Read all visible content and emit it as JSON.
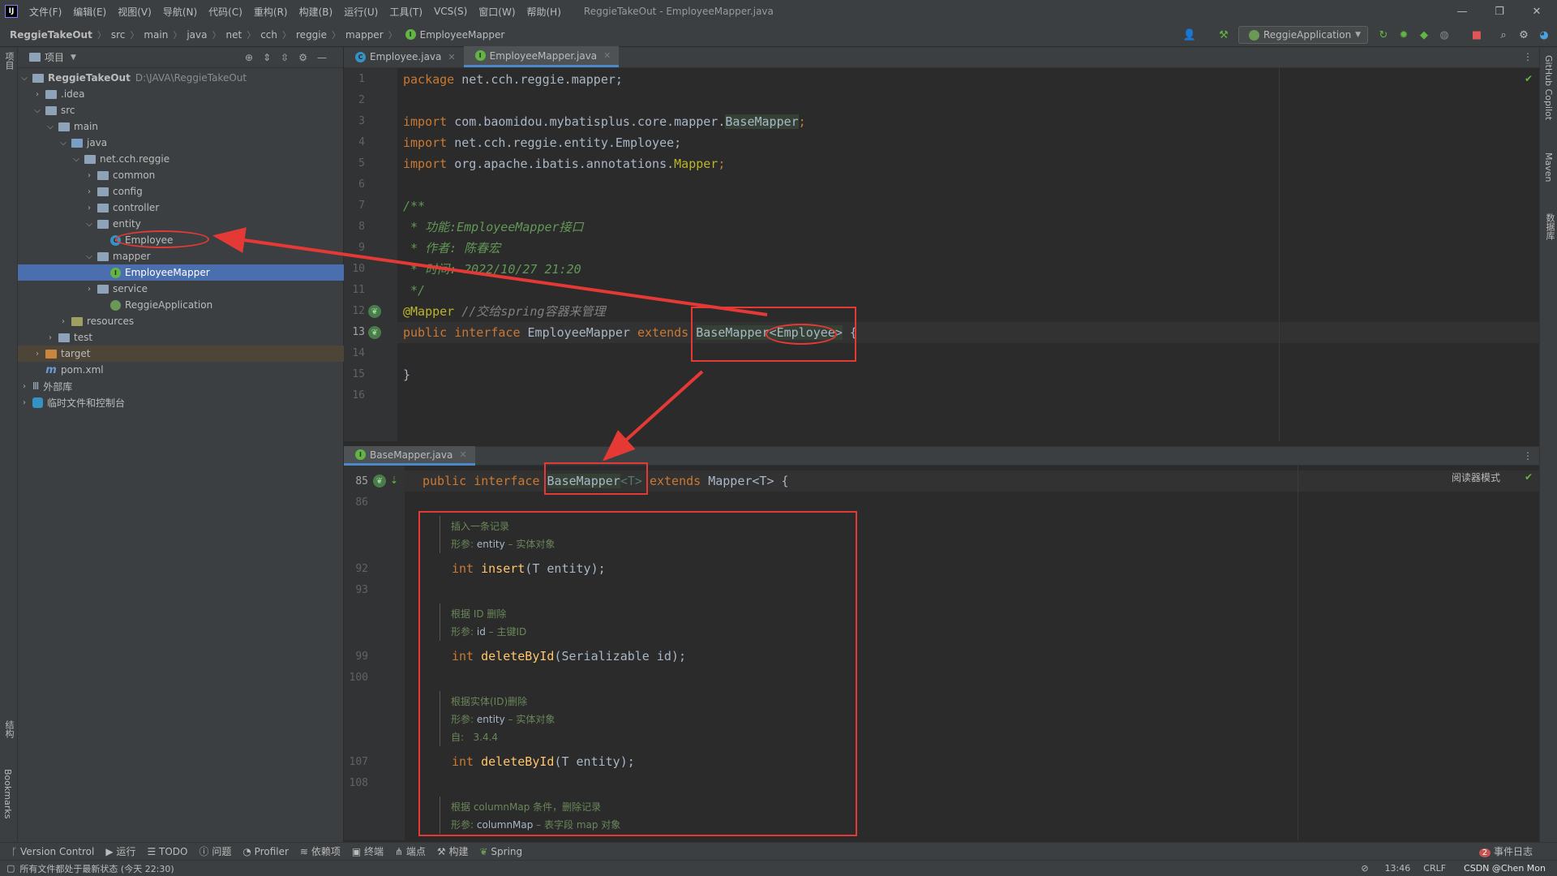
{
  "titlebar": {
    "logo": "IJ",
    "menus": [
      "文件(F)",
      "编辑(E)",
      "视图(V)",
      "导航(N)",
      "代码(C)",
      "重构(R)",
      "构建(B)",
      "运行(U)",
      "工具(T)",
      "VCS(S)",
      "窗口(W)",
      "帮助(H)"
    ],
    "title": "ReggieTakeOut - EmployeeMapper.java",
    "min": "—",
    "restore": "❐",
    "close": "✕"
  },
  "navbar": {
    "crumbs": [
      "ReggieTakeOut",
      "src",
      "main",
      "java",
      "net",
      "cch",
      "reggie",
      "mapper",
      "EmployeeMapper"
    ],
    "run_config": "ReggieApplication"
  },
  "left_stripe": {
    "project": "项目",
    "structure": "结构",
    "bookmarks": "Bookmarks"
  },
  "right_stripe": {
    "copilot": "GitHub Copilot",
    "maven": "Maven",
    "database": "数据库"
  },
  "project_panel": {
    "header": "项目",
    "tree": [
      {
        "label": "ReggieTakeOut",
        "extra": "D:\\JAVA\\ReggieTakeOut"
      },
      {
        "label": ".idea"
      },
      {
        "label": "src"
      },
      {
        "label": "main"
      },
      {
        "label": "java"
      },
      {
        "label": "net.cch.reggie"
      },
      {
        "label": "common"
      },
      {
        "label": "config"
      },
      {
        "label": "controller"
      },
      {
        "label": "entity"
      },
      {
        "label": "Employee"
      },
      {
        "label": "mapper"
      },
      {
        "label": "EmployeeMapper"
      },
      {
        "label": "service"
      },
      {
        "label": "ReggieApplication"
      },
      {
        "label": "resources"
      },
      {
        "label": "test"
      },
      {
        "label": "target"
      },
      {
        "label": "pom.xml"
      },
      {
        "label": "外部库"
      },
      {
        "label": "临时文件和控制台"
      }
    ]
  },
  "editor_tabs": [
    {
      "label": "Employee.java"
    },
    {
      "label": "EmployeeMapper.java"
    }
  ],
  "editor1": {
    "line_numbers": [
      "1",
      "2",
      "3",
      "4",
      "5",
      "6",
      "7",
      "8",
      "9",
      "10",
      "11",
      "12",
      "13",
      "14",
      "15",
      "16"
    ],
    "l1_kw": "package",
    "l1_rest": " net.cch.reggie.mapper;",
    "l3_kw": "import",
    "l3_rest": " com.baomidou.mybatisplus.core.mapper.",
    "l3_type": "BaseMapper",
    "l3_end": ";",
    "l4_kw": "import",
    "l4_rest": " net.cch.reggie.entity.Employee;",
    "l5_kw": "import",
    "l5_rest": " org.apache.ibatis.annotations.",
    "l5_type": "Mapper",
    "l5_end": ";",
    "l7": "/**",
    "l8": " * 功能:EmployeeMapper接口",
    "l9": " * 作者: 陈春宏",
    "l10": " * 时间: 2022/10/27 21:20",
    "l11": " */",
    "l12_ann": "@Mapper",
    "l12_cm": " //交给spring容器来管理",
    "l13_kw": "public interface",
    "l13_name": " EmployeeMapper ",
    "l13_kw2": "extends",
    "l13_sp": " ",
    "l13_type": "BaseMapper",
    "l13_gen": "<Employee>",
    "l13_end": " {",
    "l15": "}"
  },
  "editor2": {
    "tab": "BaseMapper.java",
    "reader_mode": "阅读器模式",
    "ln85": "85",
    "ln86": "86",
    "ln92": "92",
    "ln93": "93",
    "ln99": "99",
    "ln100": "100",
    "ln107": "107",
    "ln108": "108",
    "l85_kw": "public interface",
    "l85_type": "BaseMapper",
    "l85_gen": "<T>",
    "l85_kw2": " extends",
    "l85_rest": " Mapper<T> {",
    "doc1_a": "插入一条记录",
    "doc1_b_lbl": "形参:",
    "doc1_b_p": "entity",
    "doc1_b_d": " – 实体对象",
    "l92_kw": "int",
    "l92_fn": "insert",
    "l92_rest": "(T entity);",
    "doc2_a": "根据 ID 删除",
    "doc2_b_lbl": "形参:",
    "doc2_b_p": "id",
    "doc2_b_d": " – 主键ID",
    "l99_kw": "int",
    "l99_fn": "deleteById",
    "l99_rest": "(Serializable id);",
    "doc3_a": "根据实体(ID)删除",
    "doc3_b_lbl": "形参:",
    "doc3_b_p": "entity",
    "doc3_b_d": " – 实体对象",
    "doc3_c_lbl": "自:",
    "doc3_c_v": "3.4.4",
    "l107_kw": "int",
    "l107_fn": "deleteById",
    "l107_rest": "(T entity);",
    "doc4_a": "根据 columnMap 条件，删除记录",
    "doc4_b_lbl": "形参:",
    "doc4_b_p": "columnMap",
    "doc4_b_d": " – 表字段 map 对象"
  },
  "bottom_tools": [
    "Version Control",
    "运行",
    "TODO",
    "问题",
    "Profiler",
    "依赖项",
    "终端",
    "端点",
    "构建",
    "Spring"
  ],
  "event_log": {
    "count": "2",
    "label": "事件日志"
  },
  "status": {
    "message": "所有文件都处于最新状态 (今天 22:30)",
    "time": "13:46",
    "line_sep": "CRLF",
    "watermark": "CSDN @Chen Mon"
  },
  "colors": {
    "accent": "#4a88c7",
    "selection": "#4b6eaf",
    "annotation_red": "#e53935"
  }
}
